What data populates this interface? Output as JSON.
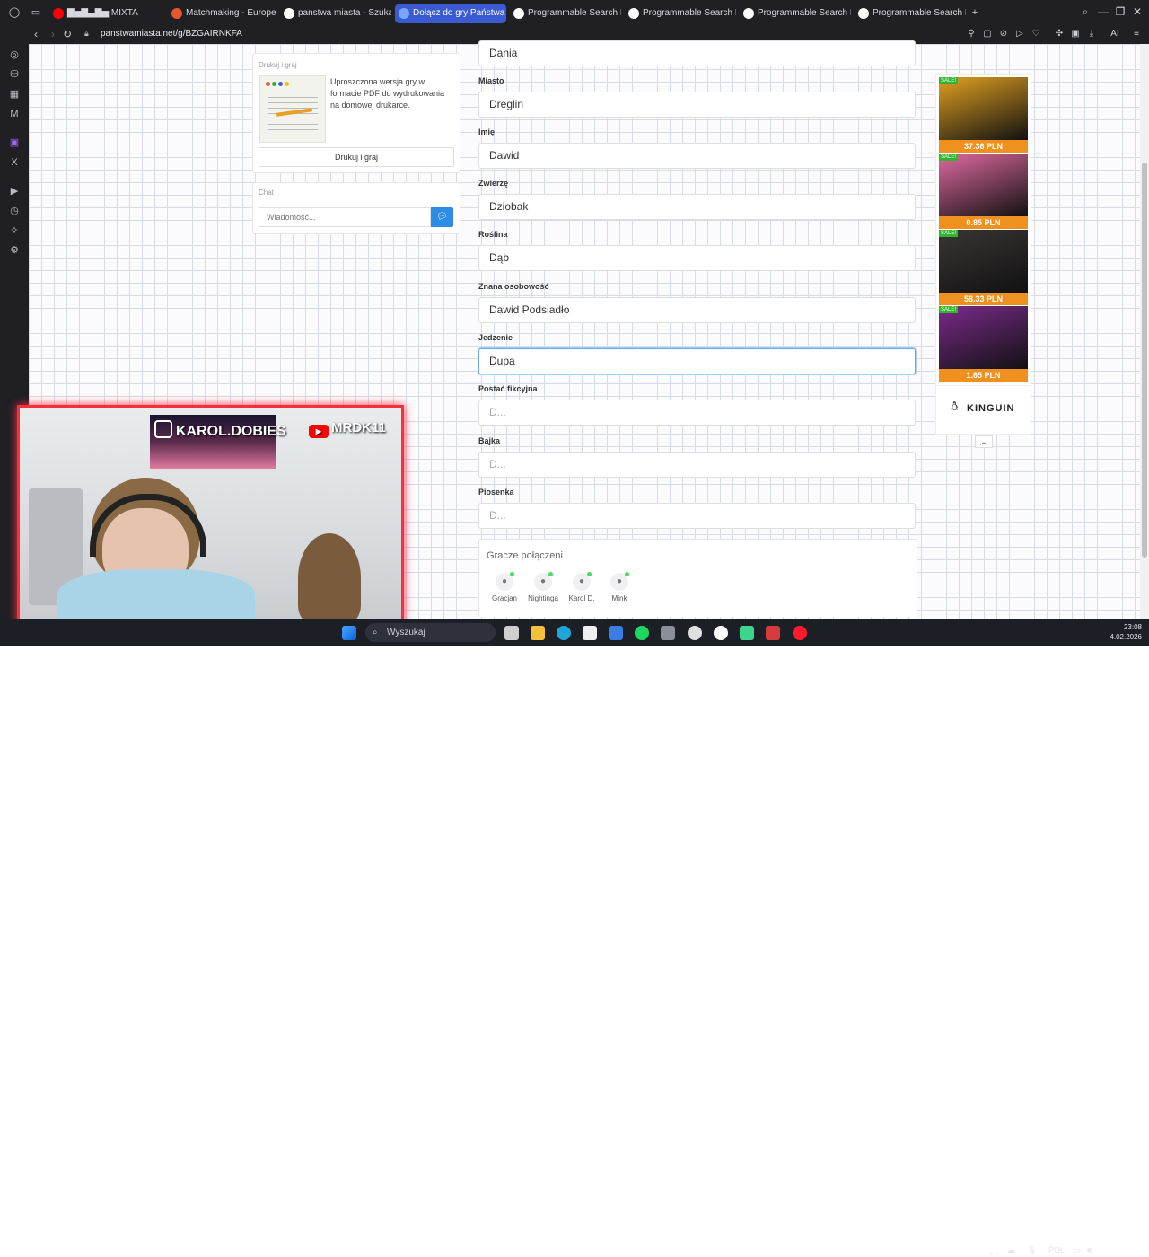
{
  "browser": {
    "tabs": [
      {
        "title": "▇▅▇▃▇▅ MIXTA",
        "favicon_color": "#ff0000"
      },
      {
        "title": "Matchmaking - Europe Sv",
        "favicon_color": "#e8572b"
      },
      {
        "title": "panstwa miasta - Szukaj w",
        "favicon_color": "#ffffff"
      },
      {
        "title": "Dołącz do gry Państwa M",
        "favicon_color": "#7aa6ff",
        "active": true
      },
      {
        "title": "Programmable Search Eng",
        "favicon_color": "#ffffff"
      },
      {
        "title": "Programmable Search Eng",
        "favicon_color": "#ffffff"
      },
      {
        "title": "Programmable Search Eng",
        "favicon_color": "#ffffff"
      },
      {
        "title": "Programmable Search Eng",
        "favicon_color": "#ffffff"
      }
    ],
    "new_tab": "+",
    "url": "panstwamiasta.net/g/BZGAIRNKFA"
  },
  "print_panel": {
    "title": "Drukuj i graj",
    "description": "Uproszczona wersja gry w formacie PDF do wydrukowania na domowej drukarce.",
    "button": "Drukuj i graj"
  },
  "chat_panel": {
    "title": "Chat",
    "placeholder": "Wiadomość..."
  },
  "form": {
    "fields": [
      {
        "label": "",
        "value": "Dania",
        "placeholder": ""
      },
      {
        "label": "Miasto",
        "value": "Dreglin",
        "placeholder": ""
      },
      {
        "label": "Imię",
        "value": "Dawid",
        "placeholder": ""
      },
      {
        "label": "Zwierzę",
        "value": "Dziobak",
        "placeholder": ""
      },
      {
        "label": "Roślina",
        "value": "Dąb",
        "placeholder": ""
      },
      {
        "label": "Znana osobowość",
        "value": "Dawid Podsiadło",
        "placeholder": ""
      },
      {
        "label": "Jedzenie",
        "value": "Dupa",
        "placeholder": "",
        "focused": true
      },
      {
        "label": "Postać fikcyjna",
        "value": "",
        "placeholder": "D..."
      },
      {
        "label": "Bajka",
        "value": "",
        "placeholder": "D..."
      },
      {
        "label": "Piosenka",
        "value": "",
        "placeholder": "D..."
      }
    ]
  },
  "players": {
    "title": "Gracze połączeni",
    "list": [
      "Gracjan",
      "Nightinga",
      "Karol D.",
      "Mink"
    ]
  },
  "ads": {
    "items": [
      {
        "badge": "SALE!",
        "price": "37.36 PLN",
        "color": "#e0a020"
      },
      {
        "badge": "SALE!",
        "price": "0.85 PLN",
        "color": "#e06aa0"
      },
      {
        "badge": "SALE!",
        "price": "58.33 PLN",
        "color": "#3a3535"
      },
      {
        "badge": "SALE!",
        "price": "1.65 PLN",
        "color": "#7a2a8a"
      }
    ],
    "brand": "KINGUIN"
  },
  "stream_overlay": {
    "instagram": "KAROL.DOBIES",
    "youtube": "MRDK11"
  },
  "taskbar": {
    "search": "Wyszukaj",
    "lang": "POL",
    "time": "23:08",
    "date": "4.02.2026"
  }
}
